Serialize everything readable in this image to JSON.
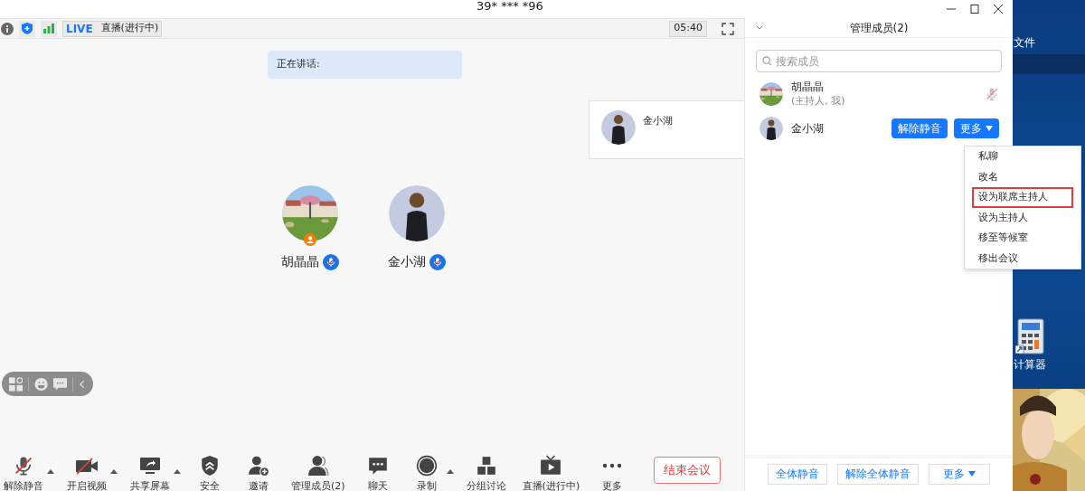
{
  "window": {
    "title": "39* *** *96"
  },
  "status_bar": {
    "live_badge": "LIVE",
    "live_status": "直播(进行中)",
    "timer": "05:40"
  },
  "speaking": {
    "label": "正在讲话:"
  },
  "video_tile": {
    "name": "金小湖"
  },
  "participants": [
    {
      "name": "胡晶晶",
      "host": true,
      "muted": true
    },
    {
      "name": "金小湖",
      "host": false,
      "muted": true
    }
  ],
  "toolbar": [
    {
      "label": "解除静音",
      "kind": "mic",
      "caret": true
    },
    {
      "label": "开启视频",
      "kind": "video",
      "caret": true
    },
    {
      "label": "共享屏幕",
      "kind": "share",
      "caret": true
    },
    {
      "label": "安全",
      "kind": "security",
      "caret": false
    },
    {
      "label": "邀请",
      "kind": "invite",
      "caret": false
    },
    {
      "label": "管理成员(2)",
      "kind": "members",
      "caret": false
    },
    {
      "label": "聊天",
      "kind": "chat",
      "caret": false
    },
    {
      "label": "录制",
      "kind": "record",
      "caret": true
    },
    {
      "label": "分组讨论",
      "kind": "breakout",
      "caret": false
    },
    {
      "label": "直播(进行中)",
      "kind": "live",
      "caret": false
    },
    {
      "label": "更多",
      "kind": "more",
      "caret": false
    }
  ],
  "end_button": "结束会议",
  "panel": {
    "title": "管理成员(2)",
    "search": {
      "placeholder": "搜索成员"
    },
    "members": [
      {
        "name": "胡晶晶",
        "subtitle": "(主持人, 我)",
        "kind": "self",
        "muted": true
      },
      {
        "name": "金小湖",
        "kind": "actions",
        "buttons": [
          "解除静音",
          "更多"
        ]
      }
    ],
    "menu": [
      {
        "label": "私聊",
        "highlighted": false
      },
      {
        "label": "改名",
        "highlighted": false
      },
      {
        "label": "设为联席主持人",
        "highlighted": true
      },
      {
        "label": "设为主持人",
        "highlighted": false
      },
      {
        "label": "移至等候室",
        "highlighted": false
      },
      {
        "label": "移出会议",
        "highlighted": false
      }
    ],
    "footer_buttons": [
      "全体静音",
      "解除全体静音",
      "更多"
    ]
  },
  "desktop": {
    "icons": [
      {
        "label": "文件",
        "kind": "folder"
      },
      {
        "label": "计算器",
        "kind": "calculator"
      }
    ]
  }
}
